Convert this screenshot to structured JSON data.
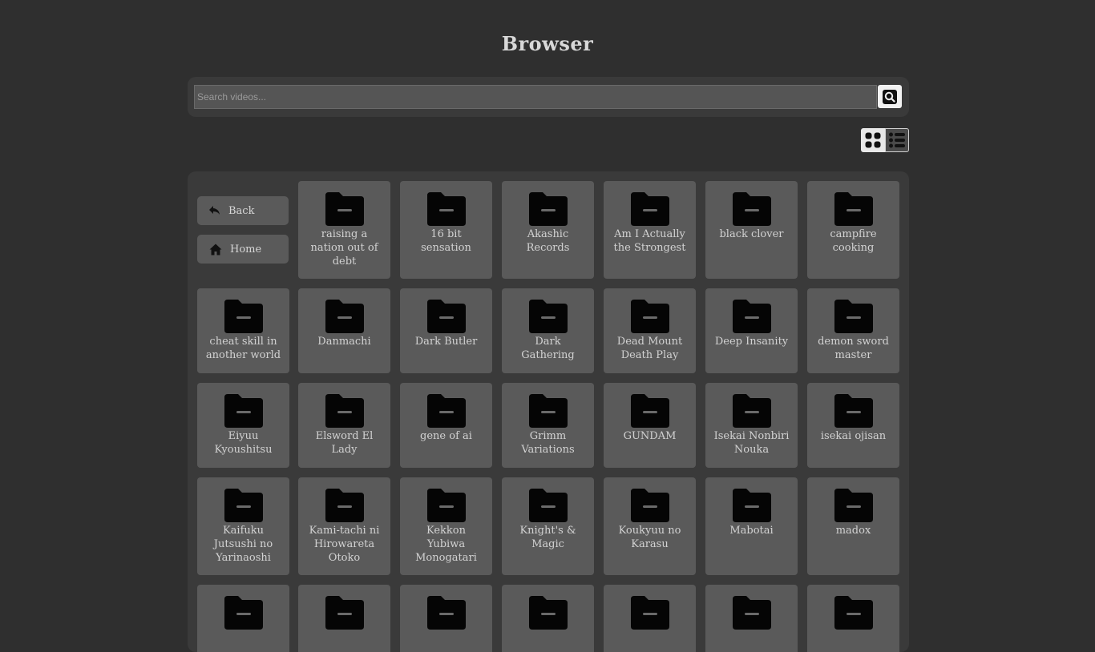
{
  "header": {
    "title": "Browser"
  },
  "search": {
    "placeholder": "Search videos...",
    "value": ""
  },
  "view_toggle": {
    "selected": "grid"
  },
  "nav": {
    "back_label": "Back",
    "home_label": "Home"
  },
  "folders": [
    "raising a nation out of debt",
    "16 bit sensation",
    "Akashic Records",
    "Am I Actually the Strongest",
    "black clover",
    "campfire cooking",
    "cheat skill in another world",
    "Danmachi",
    "Dark Butler",
    "Dark Gathering",
    "Dead Mount Death Play",
    "Deep Insanity",
    "demon sword master",
    "Eiyuu Kyoushitsu",
    "Elsword El Lady",
    "gene of ai",
    "Grimm Variations",
    "GUNDAM",
    "Isekai Nonbiri Nouka",
    "isekai ojisan",
    "Kaifuku Jutsushi no Yarinaoshi",
    "Kami-tachi ni Hirowareta Otoko",
    "Kekkon Yubiwa Monogatari",
    "Knight's & Magic",
    "Koukyuu no Karasu",
    "Mabotai",
    "madox",
    "",
    "",
    "",
    "",
    "",
    "",
    ""
  ]
}
